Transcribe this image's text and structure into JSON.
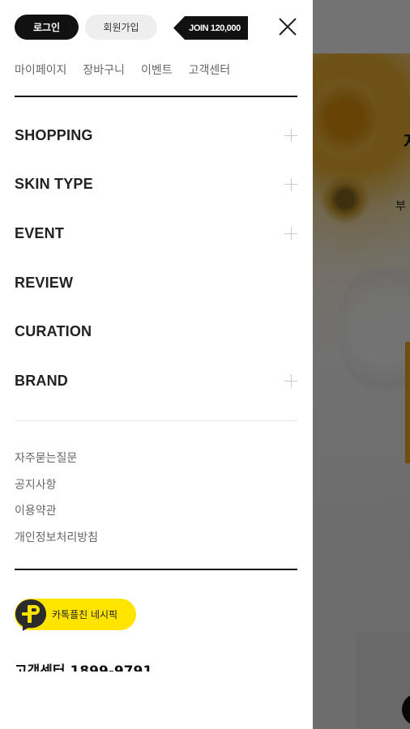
{
  "auth": {
    "login_label": "로그인",
    "signup_label": "회원가입",
    "join_badge": "JOIN 120,000"
  },
  "quick_links": [
    "마이페이지",
    "장바구니",
    "이벤트",
    "고객센터"
  ],
  "menu": [
    {
      "label": "SHOPPING",
      "expandable": true
    },
    {
      "label": "SKIN TYPE",
      "expandable": true
    },
    {
      "label": "EVENT",
      "expandable": true
    },
    {
      "label": "REVIEW",
      "expandable": false
    },
    {
      "label": "CURATION",
      "expandable": false
    },
    {
      "label": "BRAND",
      "expandable": true
    }
  ],
  "sub_links": [
    "자주묻는질문",
    "공지사항",
    "이용약관",
    "개인정보처리방침"
  ],
  "kakao": {
    "label": "카톡플친 네시픽"
  },
  "customer_center": {
    "text": "고객센터 1899-9791"
  },
  "background": {
    "hero_title": "자",
    "hero_subtitle": "부"
  },
  "colors": {
    "accent_black": "#111111",
    "kakao_yellow": "#FFE400",
    "overlay": "rgba(0,0,0,0.55)"
  },
  "icons": [
    "close-icon",
    "plus-icon",
    "menu-icon",
    "search-icon",
    "kakao-plus-friend-icon"
  ]
}
